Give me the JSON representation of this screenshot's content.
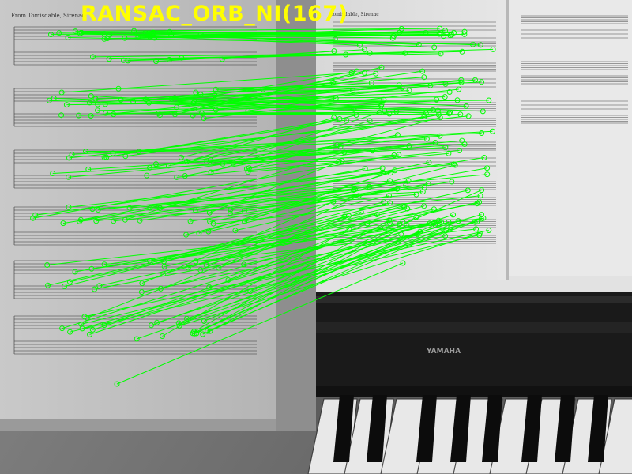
{
  "overlay": {
    "title": "RANSAC_ORB_NI(167)",
    "title_color": "#ffff00",
    "match_color": "#00ff00"
  },
  "left_image": {
    "header_text": "From Tomisdable, Sirenac"
  },
  "right_image": {
    "header_text": "Tomisdable, Sirenac",
    "brand": "YAMAHA"
  }
}
